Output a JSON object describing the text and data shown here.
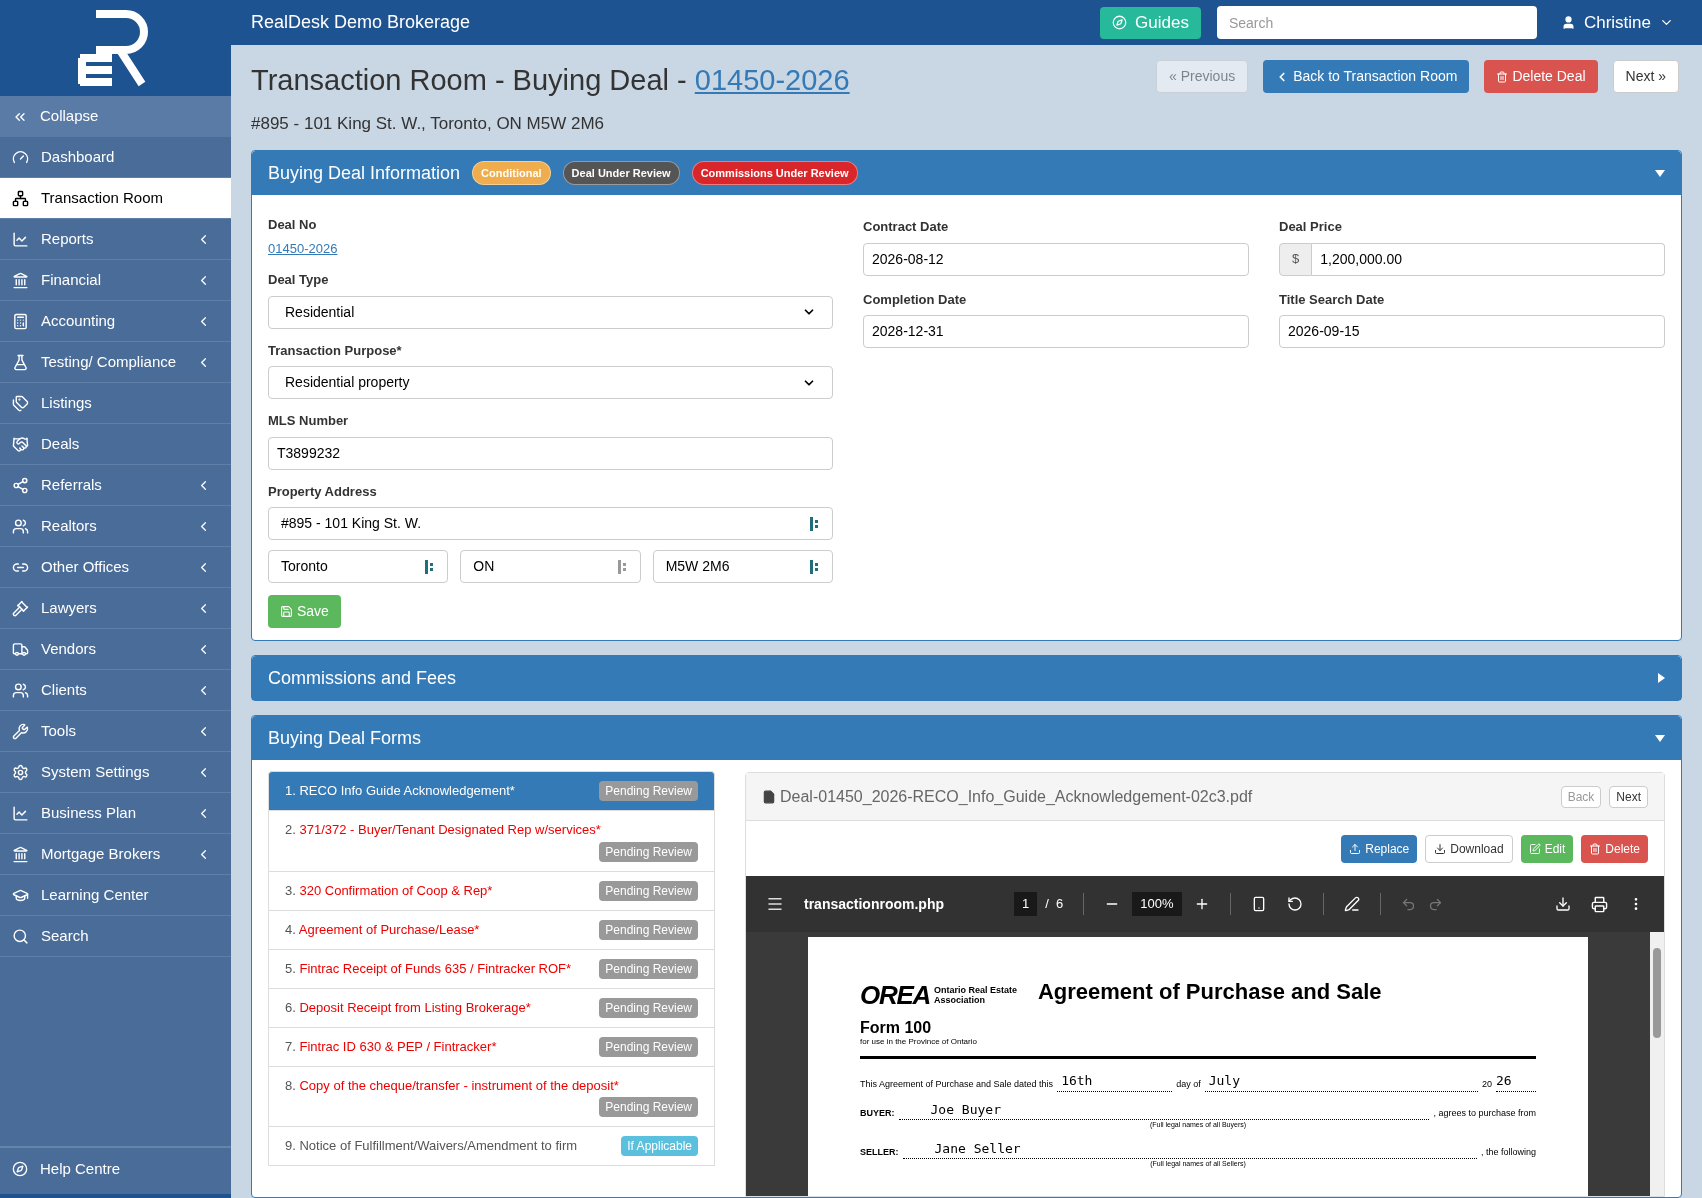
{
  "header": {
    "brand": "RealDesk Demo Brokerage",
    "guides": "Guides",
    "search": {
      "placeholder": "Search"
    },
    "user": "Christine"
  },
  "sidebar": {
    "collapse": "Collapse",
    "items": [
      {
        "label": "Dashboard",
        "selected": false,
        "submenu": false
      },
      {
        "label": "Transaction Room",
        "selected": true,
        "submenu": false
      },
      {
        "label": "Reports",
        "selected": false,
        "submenu": true
      },
      {
        "label": "Financial",
        "selected": false,
        "submenu": true
      },
      {
        "label": "Accounting",
        "selected": false,
        "submenu": true
      },
      {
        "label": "Testing/ Compliance",
        "selected": false,
        "submenu": true
      },
      {
        "label": "Listings",
        "selected": false,
        "submenu": false
      },
      {
        "label": "Deals",
        "selected": false,
        "submenu": false
      },
      {
        "label": "Referrals",
        "selected": false,
        "submenu": true
      },
      {
        "label": "Realtors",
        "selected": false,
        "submenu": true
      },
      {
        "label": "Other Offices",
        "selected": false,
        "submenu": true
      },
      {
        "label": "Lawyers",
        "selected": false,
        "submenu": true
      },
      {
        "label": "Vendors",
        "selected": false,
        "submenu": true
      },
      {
        "label": "Clients",
        "selected": false,
        "submenu": true
      },
      {
        "label": "Tools",
        "selected": false,
        "submenu": true
      },
      {
        "label": "System Settings",
        "selected": false,
        "submenu": true
      },
      {
        "label": "Business Plan",
        "selected": false,
        "submenu": true
      },
      {
        "label": "Mortgage Brokers",
        "selected": false,
        "submenu": true
      },
      {
        "label": "Learning Center",
        "selected": false,
        "submenu": false
      },
      {
        "label": "Search",
        "selected": false,
        "submenu": false
      }
    ],
    "help": "Help Centre"
  },
  "page": {
    "title": "Transaction Room - Buying Deal - ",
    "deal_link": "01450-2026",
    "address": "#895 - 101 King St. W., Toronto, ON M5W 2M6",
    "buttons": [
      {
        "label": "« Previous",
        "kind": "default",
        "disabled": true
      },
      {
        "label": "Back to Transaction Room",
        "kind": "primary",
        "disabled": false
      },
      {
        "label": "Delete Deal",
        "kind": "danger",
        "disabled": false
      },
      {
        "label": "Next »",
        "kind": "default",
        "disabled": false
      }
    ]
  },
  "deal_info": {
    "title": "Buying Deal Information",
    "expanded": true,
    "badges": [
      {
        "label": "Conditional",
        "color": "#f0ad4e"
      },
      {
        "label": "Deal Under Review",
        "color": "#555555"
      },
      {
        "label": "Commissions Under Review",
        "color": "#d9262a"
      }
    ],
    "deal_no": {
      "label": "Deal No",
      "value": "01450-2026"
    },
    "deal_type": {
      "label": "Deal Type",
      "value": "Residential"
    },
    "purpose": {
      "label": "Transaction Purpose*",
      "value": "Residential property"
    },
    "mls": {
      "label": "MLS Number",
      "value": "T3899232"
    },
    "property_address": {
      "label": "Property Address",
      "street": "#895 - 101 King St. W.",
      "city": "Toronto",
      "province": "ON",
      "postal": "M5W 2M6"
    },
    "save": "Save",
    "contract_date": {
      "label": "Contract Date",
      "value": "2026-08-12"
    },
    "completion_date": {
      "label": "Completion Date",
      "value": "2028-12-31"
    },
    "deal_price": {
      "label": "Deal Price",
      "currency": "$",
      "value": "1,200,000.00"
    },
    "title_search_date": {
      "label": "Title Search Date",
      "value": "2026-09-15"
    }
  },
  "commissions": {
    "title": "Commissions and Fees",
    "expanded": false
  },
  "forms": {
    "title": "Buying Deal Forms",
    "expanded": true,
    "items": [
      {
        "number": "1.",
        "title": "RECO Info Guide Acknowledgement*",
        "missing": false,
        "selected": true,
        "status": "Pending Review",
        "color": "#999999"
      },
      {
        "number": "2.",
        "title": "371/372 - Buyer/Tenant Designated Rep w/services*",
        "missing": true,
        "selected": false,
        "status": "Pending Review",
        "color": "#999999"
      },
      {
        "number": "3.",
        "title": "320 Confirmation of Coop & Rep*",
        "missing": true,
        "selected": false,
        "status": "Pending Review",
        "color": "#999999"
      },
      {
        "number": "4.",
        "title": "Agreement of Purchase/Lease*",
        "missing": true,
        "selected": false,
        "status": "Pending Review",
        "color": "#999999"
      },
      {
        "number": "5.",
        "title": "Fintrac Receipt of Funds 635 / Fintracker ROF*",
        "missing": true,
        "selected": false,
        "status": "Pending Review",
        "color": "#999999"
      },
      {
        "number": "6.",
        "title": "Deposit Receipt from Listing Brokerage*",
        "missing": true,
        "selected": false,
        "status": "Pending Review",
        "color": "#999999"
      },
      {
        "number": "7.",
        "title": "Fintrac ID 630 & PEP / Fintracker*",
        "missing": true,
        "selected": false,
        "status": "Pending Review",
        "color": "#999999"
      },
      {
        "number": "8.",
        "title": "Copy of the cheque/transfer - instrument of the deposit*",
        "missing": true,
        "selected": false,
        "status": "Pending Review",
        "color": "#999999"
      },
      {
        "number": "9.",
        "title": "Notice of Fulfillment/Waivers/Amendment to firm",
        "missing": false,
        "selected": false,
        "status": "If Applicable",
        "color": "#5bc0de"
      }
    ],
    "viewer": {
      "filename": "Deal-01450_2026-RECO_Info_Guide_Acknowledgement-02c3.pdf",
      "nav": [
        {
          "label": "Back",
          "disabled": true
        },
        {
          "label": "Next",
          "disabled": false
        }
      ],
      "actions": [
        {
          "label": "Replace",
          "kind": "primary"
        },
        {
          "label": "Download",
          "kind": "default"
        },
        {
          "label": "Edit",
          "kind": "success"
        },
        {
          "label": "Delete",
          "kind": "danger"
        }
      ],
      "pdf": {
        "name": "transactionroom.php",
        "page": "1",
        "separator": "/",
        "pages": "6",
        "zoom": "100%",
        "document": {
          "logo": "OREA",
          "association": "Ontario Real Estate Association",
          "title": "Agreement of Purchase and Sale",
          "form": "Form 100",
          "form_note": "for use in the Province of Ontario",
          "dated_text": "This Agreement of Purchase and Sale dated this",
          "day": "16th",
          "day_of": "day of",
          "month": "July",
          "century": "20",
          "year": "26",
          "buyer_label": "BUYER:",
          "buyer": "Joe Buyer",
          "buyer_tail": ", agrees to purchase from",
          "buyer_note": "(Full legal names of all Buyers)",
          "seller_label": "SELLER:",
          "seller": "Jane Seller",
          "seller_tail": ", the following",
          "seller_note": "(Full legal names of all Sellers)"
        }
      }
    }
  }
}
